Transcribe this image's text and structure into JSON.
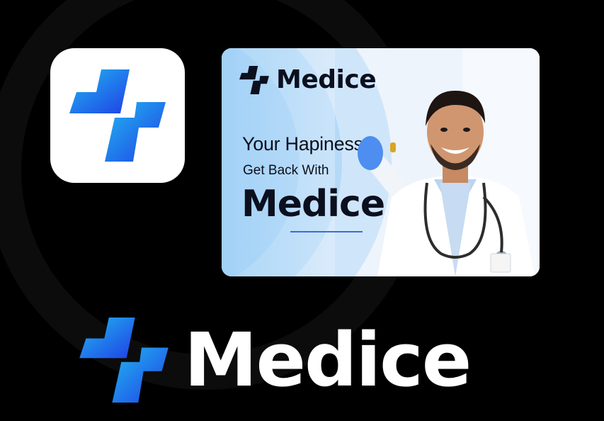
{
  "brand": {
    "name": "Medice",
    "colors": {
      "gradient_start": "#22b8f0",
      "gradient_end": "#1f3fe6",
      "background": "#000000",
      "text_dark": "#0b0f1e"
    }
  },
  "app_icon": {
    "icon": "medice-cross-logo-icon"
  },
  "banner": {
    "logo_text": "Medice",
    "line1": "Your Hapiness",
    "line2": "Get Back With",
    "line3": "Medice"
  },
  "wordmark": {
    "text": "Medice",
    "icon": "medice-cross-logo-icon"
  }
}
